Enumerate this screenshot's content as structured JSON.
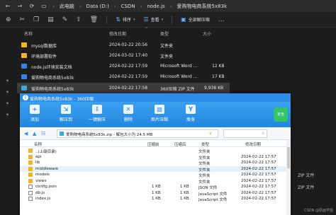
{
  "explorer": {
    "breadcrumb": [
      "此电脑",
      "Data (D:)",
      "CSDN",
      "node.js",
      "爱购物电商系统5x83k"
    ],
    "toolbar": {
      "sort_label": "排序",
      "view_label": "查看",
      "select_all_label": "全部解压缩"
    },
    "columns": {
      "name": "名称",
      "date": "修改日期",
      "type": "类型",
      "size": "大小"
    },
    "files": [
      {
        "name": "mysql数据库",
        "date": "2024-02-22 20:56",
        "type": "文件夹",
        "size": "",
        "icon": "folder-icon"
      },
      {
        "name": "环境部署软件",
        "date": "2024-03-02 17:40",
        "type": "文件夹",
        "size": "",
        "icon": "folder-icon"
      },
      {
        "name": "node.js环境安装文档",
        "date": "2024-02-22 17:59",
        "type": "Microsoft Word ...",
        "size": "12 KB",
        "icon": "word-icon"
      },
      {
        "name": "爱购物电商系统5x83k",
        "date": "2024-02-22 17:59",
        "type": "Microsoft Word ...",
        "size": "17 KB",
        "icon": "word-icon"
      },
      {
        "name": "爱购物电商系统5x83k",
        "date": "2024-02-22 17:58",
        "type": "360压缩 ZIP 文件",
        "size": "9,938 KB",
        "icon": "zip-icon"
      }
    ],
    "right_labels": [
      "ZIP 文件",
      "ZIP 文件"
    ]
  },
  "zip_window": {
    "title": "爱购物电商系统5x83k - 360压缩",
    "toolbar": [
      "添加",
      "解压到",
      "一键解压",
      "删除",
      "图片压缩",
      "瘦身"
    ],
    "safe_label": "安全",
    "address": "爱购物电商系统5x83k.zip - 解包大小为 24.5 MB",
    "columns": {
      "name": "名称",
      "packed": "压缩前",
      "compressed": "压缩后",
      "type": "类型",
      "date": "修改日期"
    },
    "rows": [
      {
        "name": "..(上级目录)",
        "packed": "",
        "compressed": "",
        "type": "文件夹",
        "date": "",
        "icon": "up"
      },
      {
        "name": "api",
        "packed": "",
        "compressed": "",
        "type": "文件夹",
        "date": "2024-02-22 17:57",
        "icon": "folder"
      },
      {
        "name": "lib",
        "packed": "",
        "compressed": "",
        "type": "文件夹",
        "date": "2024-02-22 17:57",
        "icon": "folder"
      },
      {
        "name": "middleware",
        "packed": "",
        "compressed": "",
        "type": "文件夹",
        "date": "2024-02-22 17:57",
        "icon": "folder"
      },
      {
        "name": "models",
        "packed": "",
        "compressed": "",
        "type": "文件夹",
        "date": "2024-02-22 17:57",
        "icon": "folder"
      },
      {
        "name": "views",
        "packed": "",
        "compressed": "",
        "type": "文件夹",
        "date": "2024-02-22 17:57",
        "icon": "folder"
      },
      {
        "name": "config.json",
        "packed": "1 KB",
        "compressed": "1 KB",
        "type": "JSON 文件",
        "date": "2024-02-22 17:57",
        "icon": "file"
      },
      {
        "name": "db.js",
        "packed": "1 KB",
        "compressed": "1 KB",
        "type": "JavaScript 文件",
        "date": "2024-02-22 17:57",
        "icon": "file"
      },
      {
        "name": "index.js",
        "packed": "1 KB",
        "compressed": "1 KB",
        "type": "JavaScript 文件",
        "date": "2024-02-22 17:57",
        "icon": "file"
      }
    ]
  },
  "watermark": "CSDN @原画学姐"
}
